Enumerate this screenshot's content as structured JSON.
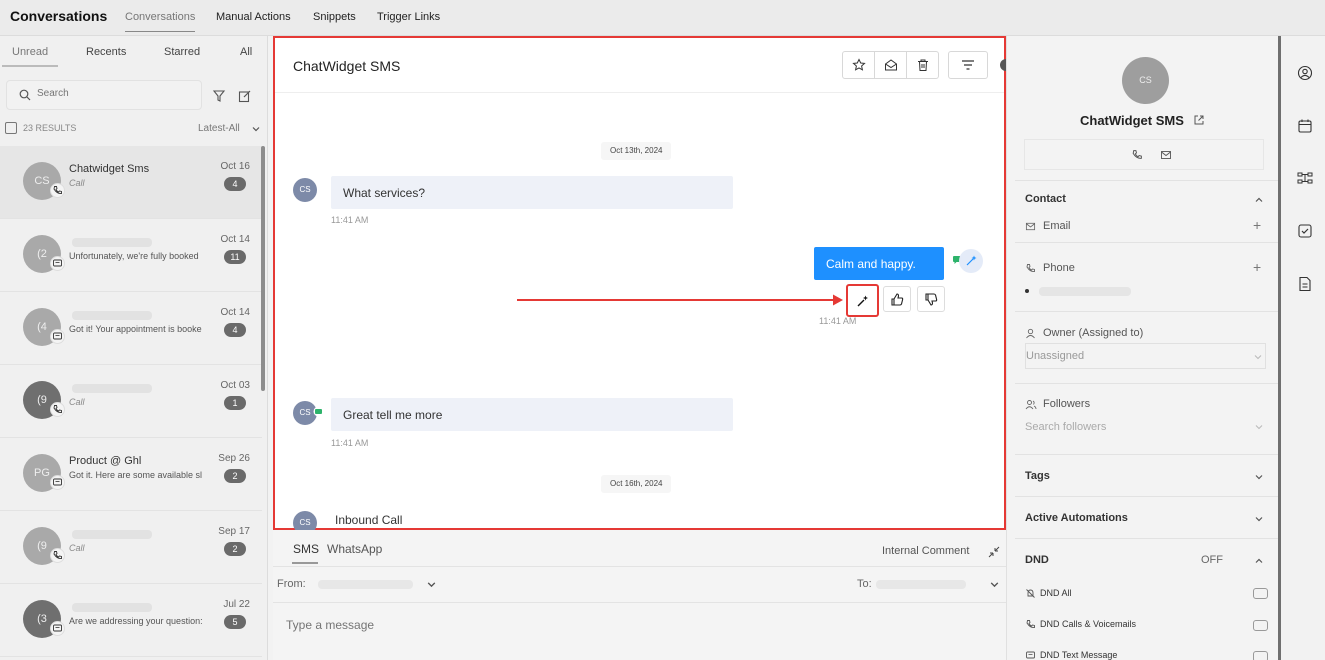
{
  "topbar": {
    "app_title": "Conversations",
    "tabs": [
      "Conversations",
      "Manual Actions",
      "Snippets",
      "Trigger Links"
    ]
  },
  "filters": {
    "tabs": [
      "Unread",
      "Recents",
      "Starred",
      "All"
    ]
  },
  "search": {
    "placeholder": "Search"
  },
  "results": {
    "count": "23 RESULTS",
    "sort": "Latest-All"
  },
  "conversations": [
    {
      "avatar": "CS",
      "name": "Chatwidget Sms",
      "preview": "Call",
      "date": "Oct 16",
      "count": "4"
    },
    {
      "avatar": "(2",
      "name": "",
      "preview": "Unfortunately, we're fully booked",
      "date": "Oct 14",
      "count": "11"
    },
    {
      "avatar": "(4",
      "name": "",
      "preview": "Got it! Your appointment is booke",
      "date": "Oct 14",
      "count": "4"
    },
    {
      "avatar": "(9",
      "name": "",
      "preview": "Call",
      "date": "Oct 03",
      "count": "1"
    },
    {
      "avatar": "PG",
      "name": "Product @ Ghl",
      "preview": "Got it. Here are some available sl",
      "date": "Sep 26",
      "count": "2"
    },
    {
      "avatar": "(9",
      "name": "",
      "preview": "Call",
      "date": "Sep 17",
      "count": "2"
    },
    {
      "avatar": "(3",
      "name": "",
      "preview": "Are we addressing your question:",
      "date": "Jul 22",
      "count": "5"
    }
  ],
  "chat": {
    "title": "ChatWidget SMS",
    "date1": "Oct 13th, 2024",
    "msg1": {
      "avatar": "CS",
      "text": "What services?",
      "time": "11:41 AM"
    },
    "msg2": {
      "text": "Calm and happy.",
      "time": "11:41 AM"
    },
    "msg3": {
      "avatar": "CS",
      "text": "Great tell me more",
      "time": "11:41 AM"
    },
    "date2": "Oct 16th, 2024",
    "msg4": {
      "avatar": "CS",
      "text": "Inbound Call"
    }
  },
  "composer": {
    "tabs": [
      "SMS",
      "WhatsApp"
    ],
    "internal": "Internal Comment",
    "from": "From:",
    "to": "To:",
    "placeholder": "Type a message"
  },
  "contact": {
    "avatar": "CS",
    "name": "ChatWidget SMS",
    "contact_title": "Contact",
    "email": "Email",
    "phone": "Phone",
    "owner_label": "Owner (Assigned to)",
    "owner_value": "Unassigned",
    "followers": "Followers",
    "followers_placeholder": "Search followers",
    "tags": "Tags",
    "automations": "Active Automations",
    "dnd": "DND",
    "dnd_state": "OFF",
    "dnd_items": [
      "DND All",
      "DND Calls & Voicemails",
      "DND Text Message"
    ]
  },
  "colors": {
    "accent": "#1e90ff",
    "highlight": "#e53935"
  }
}
